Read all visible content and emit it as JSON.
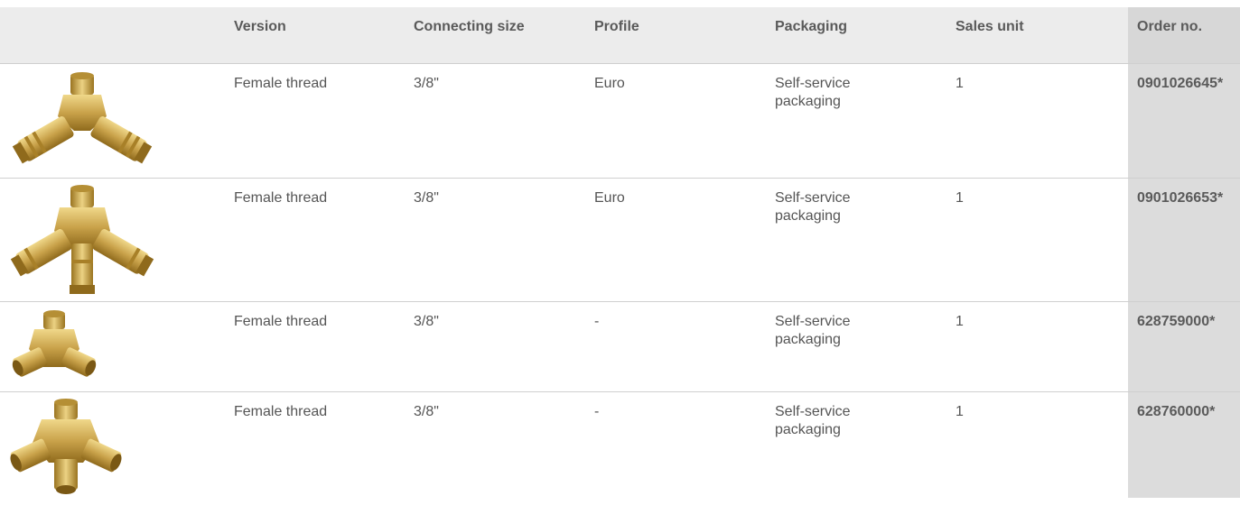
{
  "headers": {
    "image": "",
    "version": "Version",
    "connecting_size": "Connecting size",
    "profile": "Profile",
    "packaging": "Packaging",
    "sales_unit": "Sales unit",
    "order_no": "Order no."
  },
  "rows": [
    {
      "image_icon": "two-way-coupling-distributor-icon",
      "version": "Female thread",
      "connecting_size": "3/8\"",
      "profile": "Euro",
      "packaging": "Self-service packaging",
      "sales_unit": "1",
      "order_no": "0901026645*"
    },
    {
      "image_icon": "three-way-coupling-distributor-icon",
      "version": "Female thread",
      "connecting_size": "3/8\"",
      "profile": "Euro",
      "packaging": "Self-service packaging",
      "sales_unit": "1",
      "order_no": "0901026653*"
    },
    {
      "image_icon": "two-way-distributor-icon",
      "version": "Female thread",
      "connecting_size": "3/8\"",
      "profile": "-",
      "packaging": "Self-service packaging",
      "sales_unit": "1",
      "order_no": "628759000*"
    },
    {
      "image_icon": "three-way-distributor-icon",
      "version": "Female thread",
      "connecting_size": "3/8\"",
      "profile": "-",
      "packaging": "Self-service packaging",
      "sales_unit": "1",
      "order_no": "628760000*"
    }
  ],
  "colors": {
    "brass": "#c9a24a",
    "brass_dark": "#9a7420",
    "brass_light": "#e6c873",
    "header_bg": "#ececec",
    "order_bg": "#dcdcdc"
  }
}
